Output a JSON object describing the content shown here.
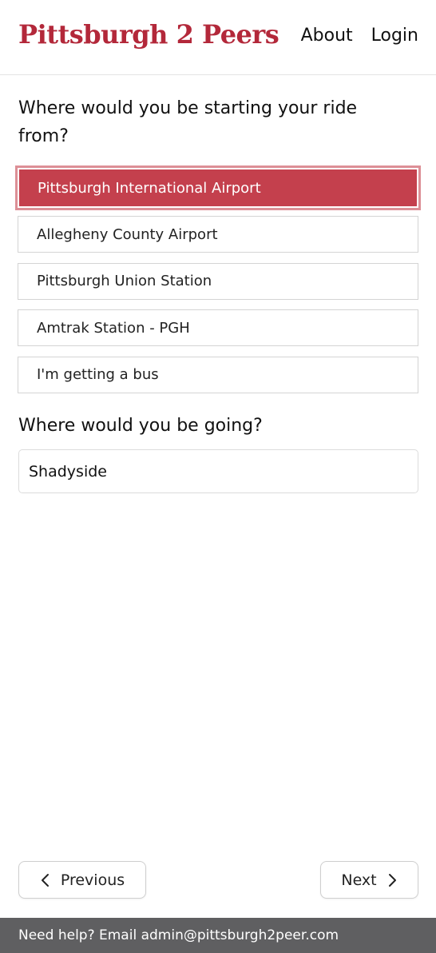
{
  "header": {
    "brand": "Pittsburgh 2 Peers",
    "nav": {
      "about": "About",
      "login": "Login"
    }
  },
  "form": {
    "start_question": "Where would you be starting your ride from?",
    "start_options": [
      {
        "label": "Pittsburgh International Airport",
        "selected": true
      },
      {
        "label": "Allegheny County Airport",
        "selected": false
      },
      {
        "label": "Pittsburgh Union Station",
        "selected": false
      },
      {
        "label": "Amtrak Station - PGH",
        "selected": false
      },
      {
        "label": "I'm getting a bus",
        "selected": false
      }
    ],
    "destination_question": "Where would you be going?",
    "destination_value": "Shadyside"
  },
  "navigation": {
    "previous_label": "Previous",
    "next_label": "Next"
  },
  "footer": {
    "help_text": "Need help? Email admin@pittsburgh2peer.com"
  },
  "colors": {
    "brand": "#b3283a",
    "selected_option": "#c4404d",
    "footer_bg": "#5f5f61"
  }
}
